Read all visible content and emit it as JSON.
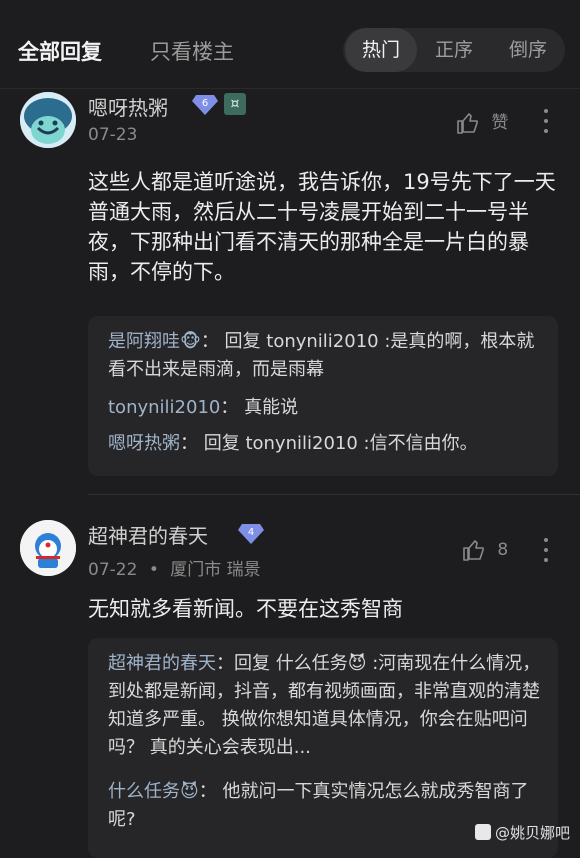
{
  "tabs": {
    "all": "全部回复",
    "owner_only": "只看楼主"
  },
  "sort": {
    "hot": "热门",
    "asc": "正序",
    "desc": "倒序"
  },
  "comments": [
    {
      "username": "嗯呀热粥",
      "level": "6",
      "date": "07-23",
      "like_label": "赞",
      "text": "这些人都是道听途说，我告诉你，19号先下了一天普通大雨，然后从二十号凌晨开始到二十一号半夜，下那种出门看不清天的那种全是一片白的暴雨，不停的下。",
      "replies": [
        {
          "name": "是阿翔哇🐵",
          "sep": "：",
          "text": "回复 tonynili2010 :是真的啊，根本就看不出来是雨滴，而是雨幕"
        },
        {
          "name": "tonynili2010",
          "sep": "：",
          "text": "真能说"
        },
        {
          "name": "嗯呀热粥",
          "sep": "：",
          "text": "回复 tonynili2010 :信不信由你。"
        }
      ]
    },
    {
      "username": "超神君的春天",
      "level": "4",
      "date": "07-22",
      "location": "厦门市 瑞景",
      "likes": "8",
      "text": "无知就多看新闻。不要在这秀智商",
      "replies": [
        {
          "name": "超神君的春天",
          "sep": "：",
          "text": "回复 什么任务😈 :河南现在什么情况，到处都是新闻，抖音，都有视频画面，非常直观的清楚知道多严重。 换做你想知道具体情况，你会在贴吧问吗？ 真的关心会表现出..."
        },
        {
          "name": "什么任务😈",
          "sep": "：",
          "text": "他就问一下真实情况怎么就成秀智商了呢?"
        }
      ]
    }
  ],
  "watermark": "@姚贝娜吧",
  "colors": {
    "background": "#1d1d1f",
    "card": "#262628",
    "reply_name": "#9fb3c8",
    "gem": "#7f8fe6"
  }
}
